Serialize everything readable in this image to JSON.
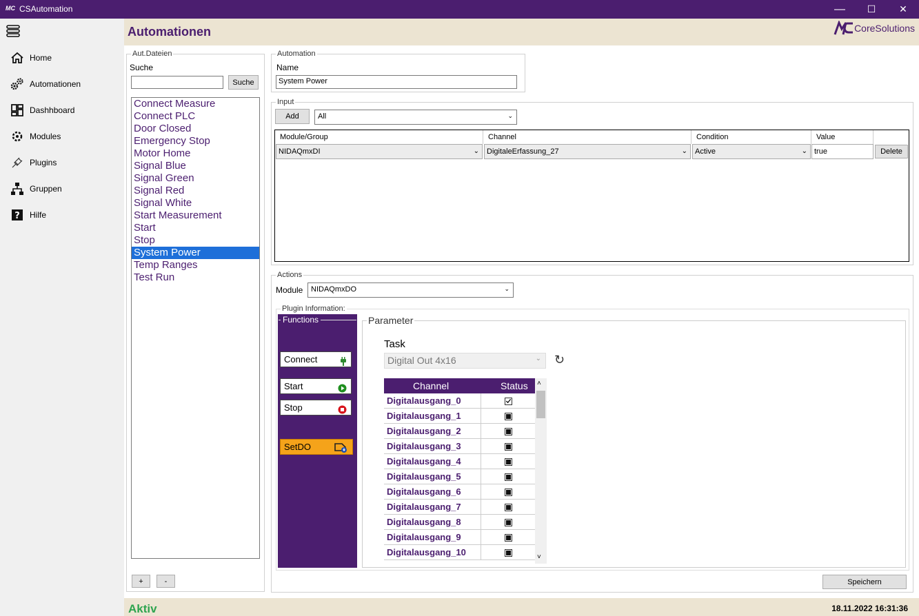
{
  "app": {
    "title": "CSAutomation",
    "logo_text": "MC"
  },
  "window": {
    "minimize": "—",
    "maximize": "☐",
    "close": "✕"
  },
  "nav": [
    {
      "label": "Home",
      "icon": "home-icon"
    },
    {
      "label": "Automationen",
      "icon": "gears-icon"
    },
    {
      "label": "Dashhboard",
      "icon": "dashboard-icon"
    },
    {
      "label": "Modules",
      "icon": "modules-icon"
    },
    {
      "label": "Plugins",
      "icon": "plug-icon"
    },
    {
      "label": "Gruppen",
      "icon": "hierarchy-icon"
    },
    {
      "label": "Hilfe",
      "icon": "help-icon"
    }
  ],
  "header": {
    "title": "Automationen",
    "brand_logo": "MC",
    "brand_name": "CoreSolutions"
  },
  "files": {
    "legend": "Aut.Dateien",
    "search_label": "Suche",
    "search_value": "",
    "search_button": "Suche",
    "items": [
      "Connect Measure",
      "Connect PLC",
      "Door Closed",
      "Emergency Stop",
      "Motor Home",
      "Signal Blue",
      "Signal Green",
      "Signal Red",
      "Signal White",
      "Start Measurement",
      "Start",
      "Stop",
      "System Power",
      "Temp Ranges",
      "Test Run"
    ],
    "selected": "System Power",
    "add_button": "+",
    "remove_button": "-"
  },
  "automation": {
    "legend": "Automation",
    "name_label": "Name",
    "name_value": "System Power"
  },
  "input": {
    "legend": "Input",
    "add_button": "Add",
    "filter_value": "All",
    "columns": [
      "Module/Group",
      "Channel",
      "Condition",
      "Value"
    ],
    "rows": [
      {
        "module": "NIDAQmxDI",
        "channel": "DigitaleErfassung_27",
        "condition": "Active",
        "value": "true",
        "delete": "Delete"
      }
    ]
  },
  "actions": {
    "legend": "Actions",
    "module_label": "Module",
    "module_value": "NIDAQmxDO",
    "plugin_info_label": "Plugin Information:",
    "functions_legend": "Functions",
    "functions": [
      {
        "label": "Connect",
        "icon": "plug-icon"
      },
      {
        "label": "Start",
        "icon": "play-icon"
      },
      {
        "label": "Stop",
        "icon": "stop-icon"
      },
      {
        "label": "SetDO",
        "icon": "setdo-icon"
      }
    ],
    "parameter_legend": "Parameter",
    "task_label": "Task",
    "task_value": "Digital Out 4x16",
    "channel_header": "Channel",
    "status_header": "Status",
    "channels": [
      {
        "name": "Digitalausgang_0",
        "checked": true
      },
      {
        "name": "Digitalausgang_1",
        "checked": false
      },
      {
        "name": "Digitalausgang_2",
        "checked": false
      },
      {
        "name": "Digitalausgang_3",
        "checked": false
      },
      {
        "name": "Digitalausgang_4",
        "checked": false
      },
      {
        "name": "Digitalausgang_5",
        "checked": false
      },
      {
        "name": "Digitalausgang_6",
        "checked": false
      },
      {
        "name": "Digitalausgang_7",
        "checked": false
      },
      {
        "name": "Digitalausgang_8",
        "checked": false
      },
      {
        "name": "Digitalausgang_9",
        "checked": false
      },
      {
        "name": "Digitalausgang_10",
        "checked": false
      }
    ]
  },
  "save_button": "Speichern",
  "status": {
    "text": "Aktiv",
    "datetime": "18.11.2022 16:31:36"
  },
  "colors": {
    "brand": "#4b1e6f",
    "header_bg": "#ece4d2",
    "selection": "#1e6fd9",
    "active_green": "#2ea44f",
    "setdo_orange": "#f5a31a"
  }
}
